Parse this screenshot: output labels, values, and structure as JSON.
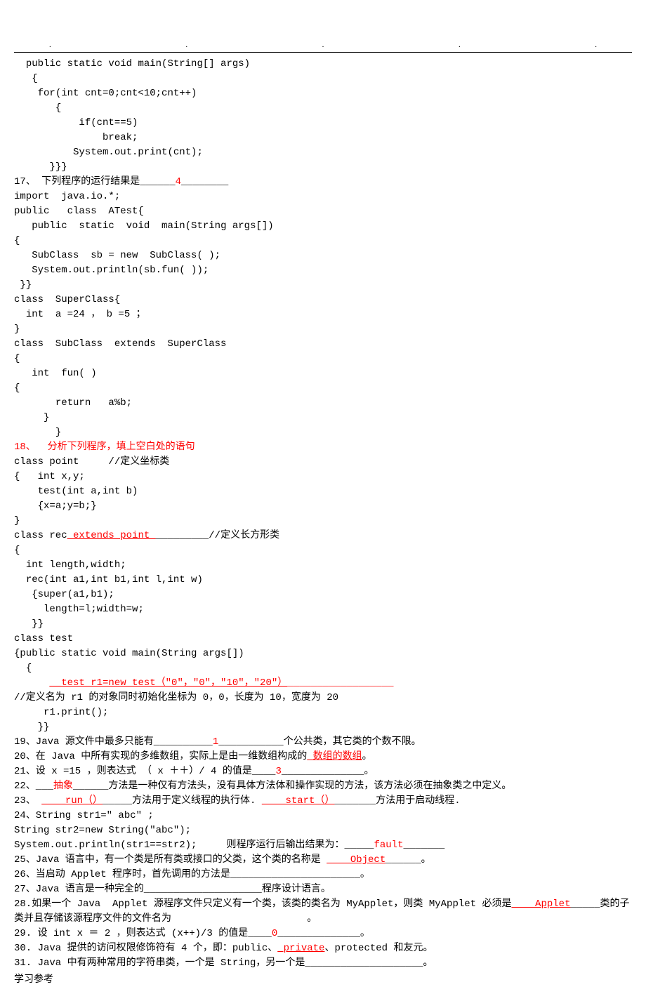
{
  "header_dots": [
    ".",
    ".",
    ".",
    ".",
    "."
  ],
  "code_block_1": [
    "  public static void main(String[] args)",
    "   {",
    "    for(int cnt=0;cnt<10;cnt++)",
    "       {",
    "           if(cnt==5)",
    "               break;",
    "          System.out.print(cnt);",
    "      }}}"
  ],
  "q17_prefix": "17、 下列程序的运行结果是______",
  "q17_answer": "4",
  "q17_suffix": "________",
  "code_block_2": [
    "import  java.io.*;",
    "public   class  ATest{",
    "   public  static  void  main(String args[])",
    "{",
    "   SubClass  sb = new  SubClass( );",
    "   System.out.println(sb.fun( ));",
    " }}",
    "class  SuperClass{",
    "  int  a =24 ， b =5 ；",
    "}",
    "class  SubClass  extends  SuperClass",
    "{",
    "   int  fun( )",
    "{",
    "       return   a%b;",
    "     }",
    "       }"
  ],
  "q18": "18、  分析下列程序，填上空白处的语句",
  "code_block_3a": [
    "class point     //定义坐标类",
    "{   int x,y;",
    "    test(int a,int b)",
    "    {x=a;y=b;}",
    "}"
  ],
  "line_rec_prefix": "class rec",
  "line_rec_answer": " extends point ",
  "line_rec_suffix": "_________//定义长方形类",
  "code_block_3b": [
    "{",
    "  int length,width;",
    "  rec(int a1,int b1,int l,int w)",
    "   {super(a1,b1);",
    "     length=l;width=w;",
    "   }}",
    "class test",
    "{public static void main(String args[])",
    "  {"
  ],
  "line_test_indent": "      ",
  "line_test_answer": "__test r1=new test（\"0\"，\"0\"，\"10\"，\"20\"）",
  "line_test_suffix": "__________________",
  "code_block_3c": [
    "//定义名为 r1 的对象同时初始化坐标为 0，0，长度为 10，宽度为 20",
    "     r1.print();",
    "    }}"
  ],
  "q19_prefix": "19、Java 源文件中最多只能有__________",
  "q19_answer": "1",
  "q19_suffix": "___________个公共类，其它类的个数不限。",
  "q20_prefix": "20、在 Java 中所有实现的多维数组，实际上是由一维数组构成的",
  "q20_answer": " 数组的数组",
  "q20_suffix": "。",
  "q21_prefix": "21、设 x =15 ，则表达式 （ x ＋＋）/ 4 的值是____",
  "q21_answer": "3",
  "q21_suffix": "______________。",
  "q22_prefix": "22、___",
  "q22_answer": "抽象",
  "q22_suffix": "______方法是一种仅有方法头，没有具体方法体和操作实现的方法，该方法必须在抽象类之中定义。",
  "q23_prefix": "23、 ",
  "q23_answer1": "____run（）",
  "q23_mid": "_____方法用于定义线程的执行体. ",
  "q23_answer2": "____start（）",
  "q23_suffix": "_______方法用于启动线程.",
  "q24_lines": [
    "24、String str1=\" abc\" ;",
    "String str2=new String(\"abc\");"
  ],
  "q24_prefix": "System.out.println(str1==str2);     则程序运行后输出结果为：_____",
  "q24_answer": "fault",
  "q24_suffix": "_______",
  "q25_prefix": "25、Java 语言中，有一个类是所有类或接口的父类，这个类的名称是 ",
  "q25_answer": "____Object",
  "q25_suffix": "______。",
  "q26": "26、当启动 Applet 程序时，首先调用的方法是______________________。",
  "q27": "27、Java 语言是一种完全的____________________程序设计语言。",
  "q28_prefix": "28.如果一个 Java  Applet 源程序文件只定义有一个类，该类的类名为 MyApplet，则类 MyApplet 必须是",
  "q28_answer": "____Applet",
  "q28_suffix": "_____类的子类并且存储该源程序文件的文件名为                       。",
  "q29_prefix": "29. 设 int x ＝ 2 ，则表达式 (x++)/3 的值是____",
  "q29_answer": "0",
  "q29_suffix": "______________。",
  "q30_prefix": "30. Java 提供的访问权限修饰符有 4 个，即：public、",
  "q30_answer": " private",
  "q30_suffix": "、protected 和友元。",
  "q31": "31. Java 中有两种常用的字符串类，一个是 String，另一个是____________________。",
  "footer": "学习参考"
}
